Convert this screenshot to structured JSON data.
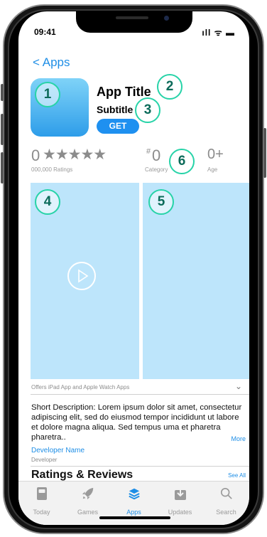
{
  "status": {
    "time": "09:41",
    "icons": "ıll ᯤ ▬"
  },
  "nav": {
    "back_label": "Apps"
  },
  "app": {
    "title": "App Title",
    "subtitle": "Subtitle",
    "get_label": "GET"
  },
  "badges": [
    "1",
    "2",
    "3",
    "4",
    "5",
    "6"
  ],
  "info": {
    "rating_value": "0",
    "stars": "★★★★★",
    "ratings_caption": "000,000 Ratings",
    "rank_hash": "#",
    "rank_value": "0",
    "rank_caption": "Category",
    "age_value": "0+",
    "age_caption": "Age"
  },
  "offers": {
    "text": "Offers iPad App and Apple Watch Apps",
    "chevron": "⌄"
  },
  "description": {
    "text": "Short Description: Lorem ipsum dolor sit amet, consectetur adipiscing elit, sed do eiusmod tempor incididunt ut labore et dolore magna aliqua. Sed tempus uma et pharetra pharetra..",
    "more_label": "More"
  },
  "developer": {
    "name": "Developer Name",
    "label": "Developer"
  },
  "ratings_reviews": {
    "heading": "Ratings & Reviews",
    "see_all": "See All"
  },
  "tabs": [
    {
      "label": "Today",
      "icon": "today-icon"
    },
    {
      "label": "Games",
      "icon": "rocket-icon"
    },
    {
      "label": "Apps",
      "icon": "layers-icon"
    },
    {
      "label": "Updates",
      "icon": "download-icon"
    },
    {
      "label": "Search",
      "icon": "search-icon"
    }
  ],
  "colors": {
    "accent": "#1e8ee6",
    "badge_border": "#27d3a8",
    "screenshot_fill": "#bde5fb",
    "tab_inactive": "#9a9a9a"
  }
}
